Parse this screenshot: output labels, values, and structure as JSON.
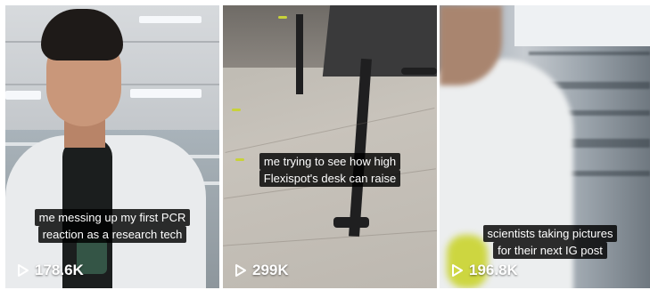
{
  "videos": [
    {
      "caption_lines": [
        "me messing up my first PCR",
        "reaction as a research tech"
      ],
      "views": "178.6K",
      "icon": "play-icon"
    },
    {
      "caption_lines": [
        "me trying to see how high",
        "Flexispot's desk can raise"
      ],
      "views": "299K",
      "icon": "play-icon"
    },
    {
      "caption_lines": [
        "scientists taking pictures",
        "for their next IG post"
      ],
      "views": "196.8K",
      "icon": "play-icon"
    }
  ],
  "colors": {
    "caption_bg": "#000000",
    "text": "#ffffff",
    "background": "#ffffff"
  }
}
